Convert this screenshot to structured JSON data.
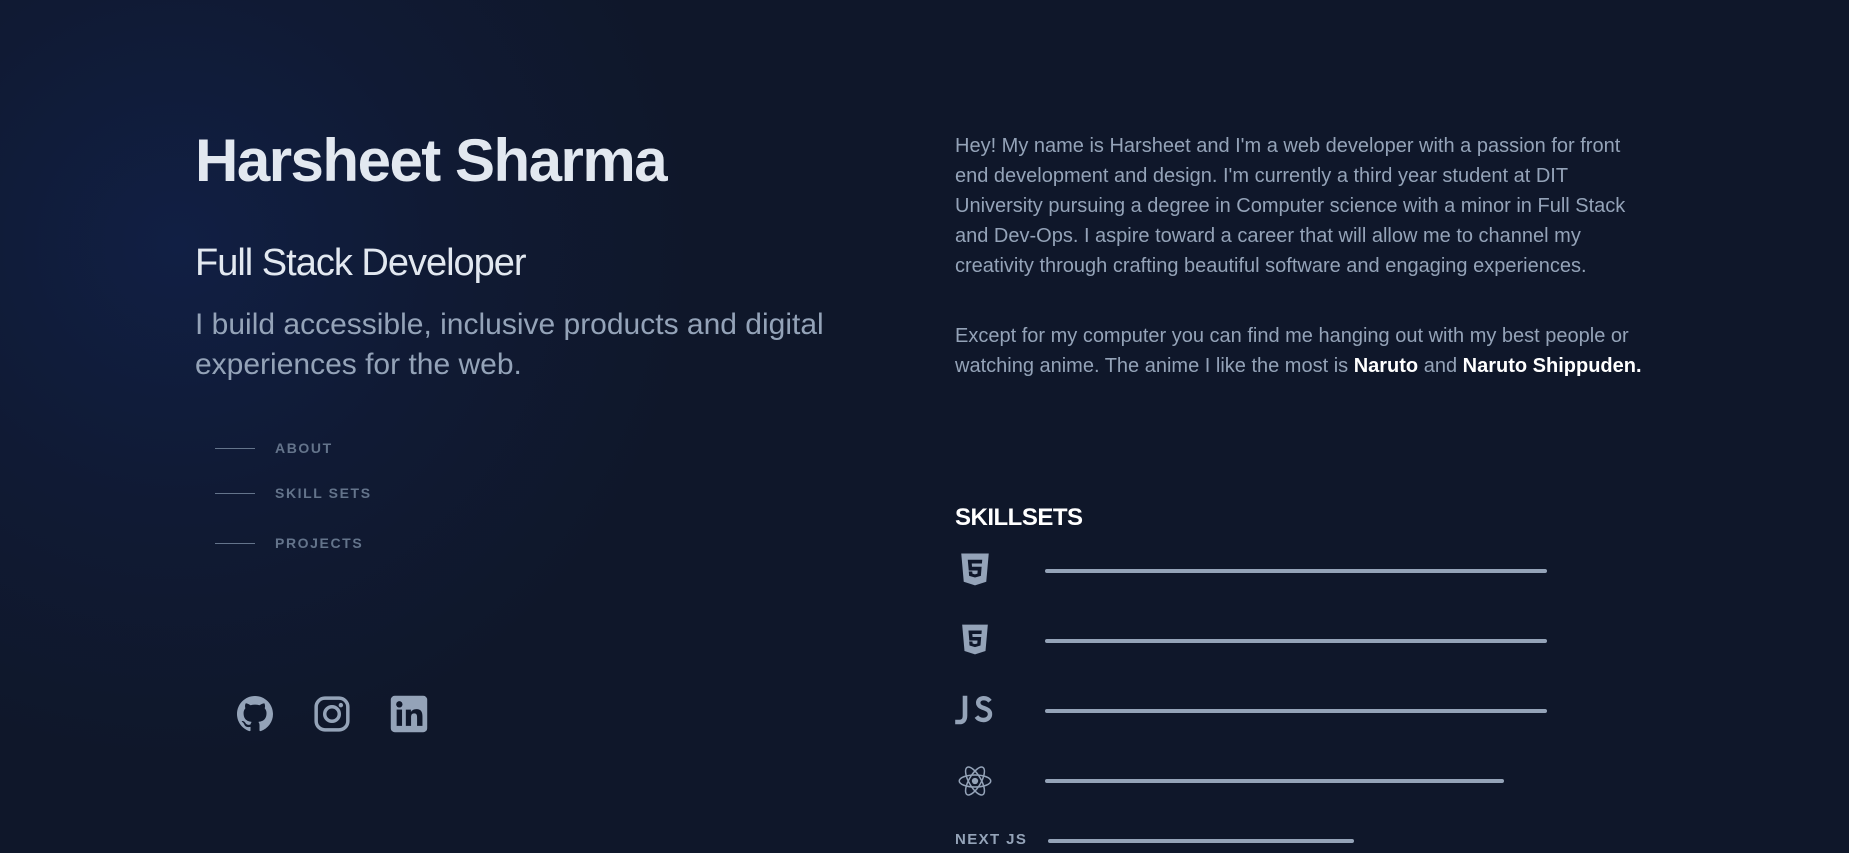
{
  "profile": {
    "name": "Harsheet Sharma",
    "role": "Full Stack Developer",
    "tagline": "I build accessible, inclusive products and digital experiences for the web."
  },
  "nav": {
    "items": [
      {
        "label": "ABOUT"
      },
      {
        "label": "SKILL SETS"
      },
      {
        "label": "PROJECTS"
      }
    ]
  },
  "socials": [
    {
      "icon": "github-icon"
    },
    {
      "icon": "instagram-icon"
    },
    {
      "icon": "linkedin-icon"
    }
  ],
  "about": {
    "paragraph1": "Hey! My name is Harsheet and I'm a web developer with a passion for front end development and design. I'm currently a third year student at DIT University pursuing a degree in Computer science with a minor in Full Stack and Dev-Ops. I aspire toward a career that will allow me to channel my creativity through crafting beautiful software and engaging experiences.",
    "paragraph2_start": "Except for my computer you can find me hanging out with my best people or watching anime. The anime I like the most is ",
    "anime1": "Naruto",
    "paragraph2_mid": " and ",
    "anime2": "Naruto Shippuden."
  },
  "skills": {
    "title": "SKILLSETS",
    "items": [
      {
        "icon": "html5-icon",
        "level": 1.0
      },
      {
        "icon": "css3-icon",
        "level": 1.0
      },
      {
        "icon": "javascript-icon",
        "level": 1.0
      },
      {
        "icon": "react-icon",
        "level": 0.915
      },
      {
        "label": "NEXT JS",
        "level": 0.61
      }
    ]
  },
  "colors": {
    "background": "#0f172a",
    "heading": "#e2e8f0",
    "body_text": "#94a3b8",
    "muted": "#64748b",
    "highlight": "#ffffff",
    "bar": "#94a3b8"
  }
}
